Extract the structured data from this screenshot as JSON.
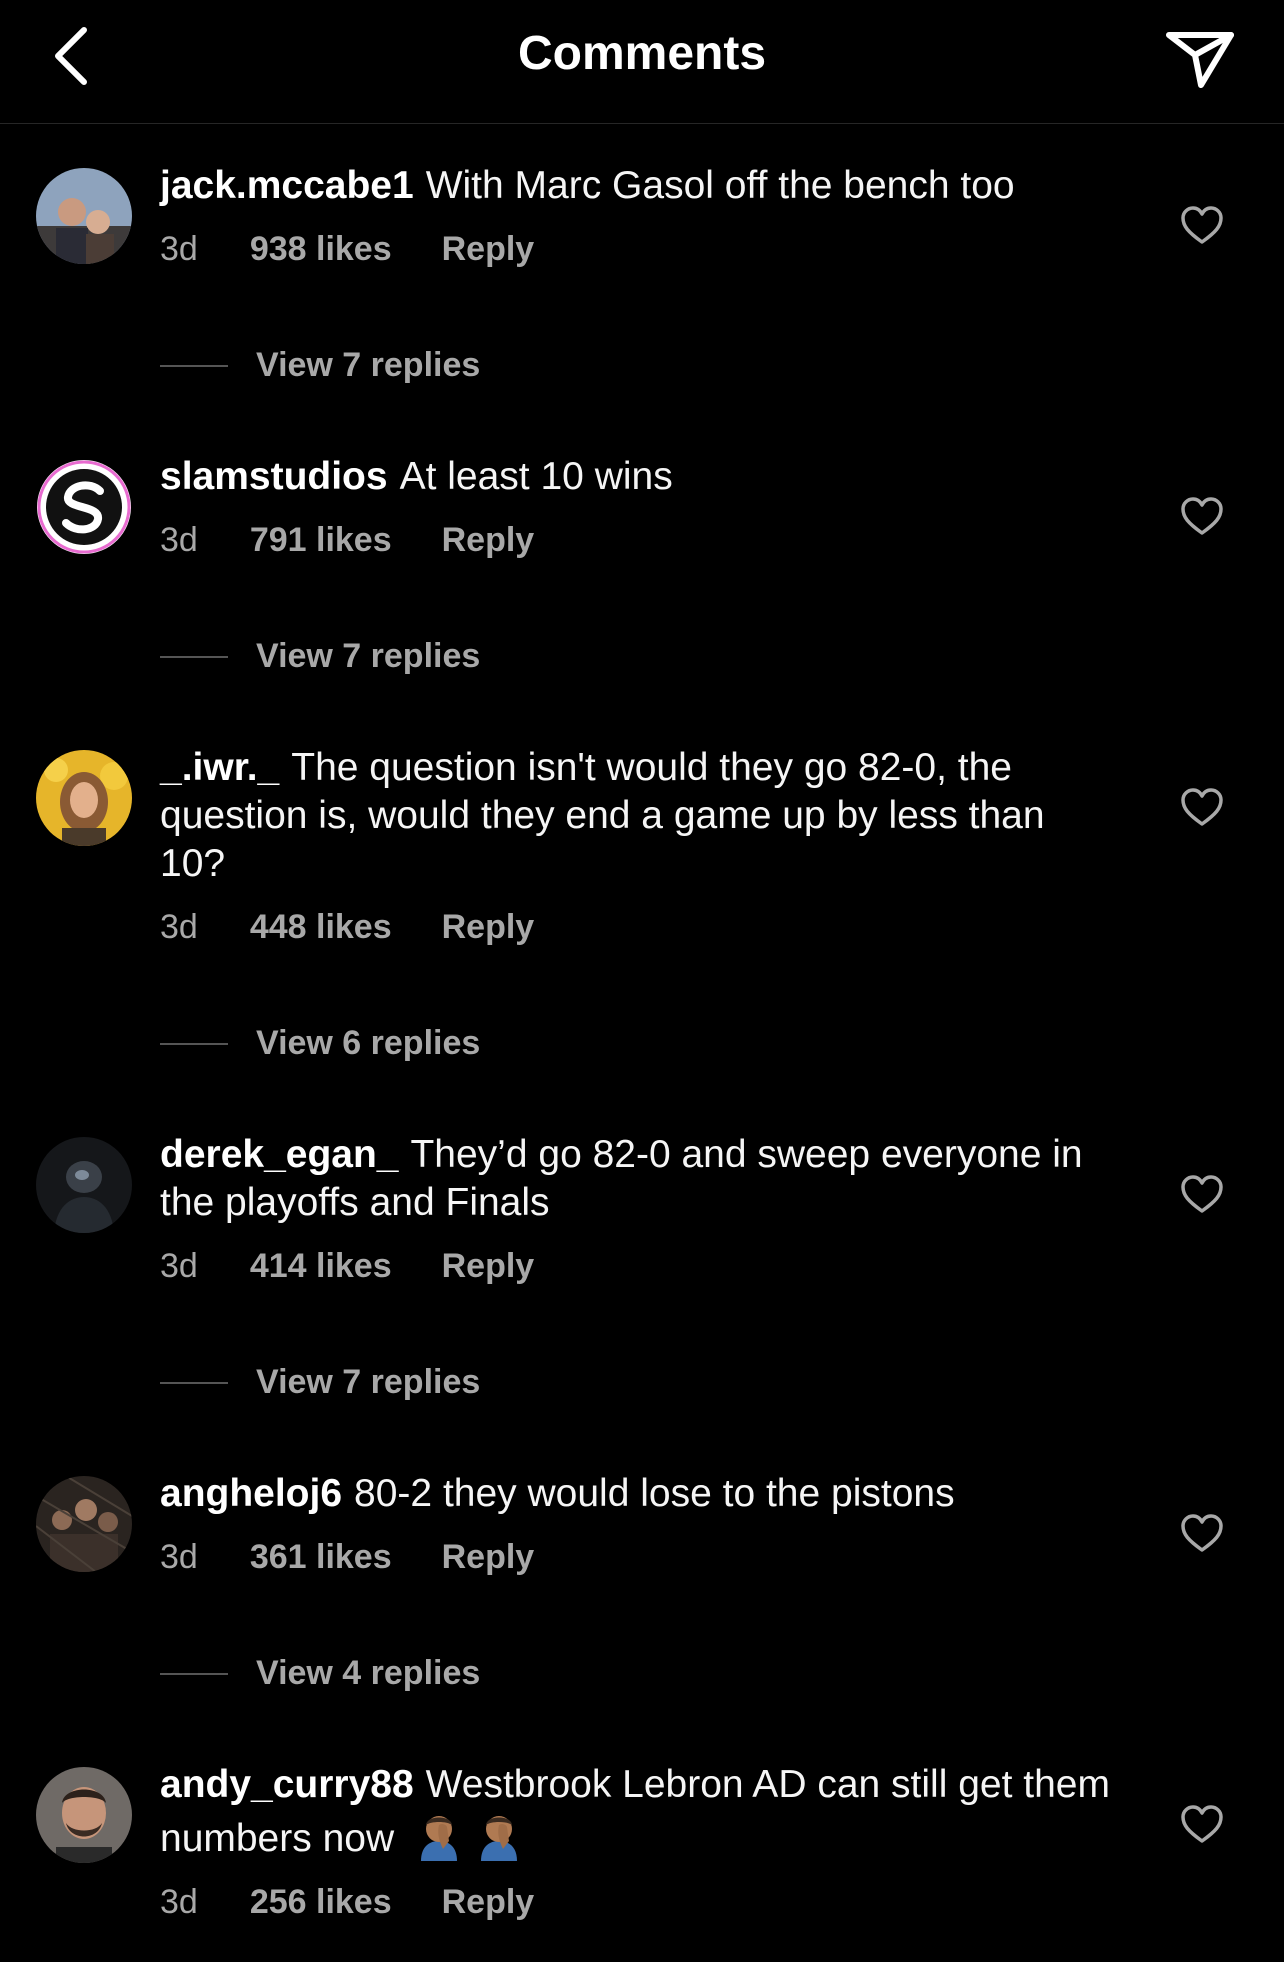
{
  "header": {
    "title": "Comments",
    "back_icon": "chevron-left-icon",
    "send_icon": "paper-plane-icon"
  },
  "comments": [
    {
      "username": "jack.mccabe1",
      "text": "With Marc Gasol off the bench too",
      "time": "3d",
      "likes": "938 likes",
      "reply": "Reply",
      "view_replies": "View 7 replies"
    },
    {
      "username": "slamstudios",
      "text": "At least 10 wins",
      "time": "3d",
      "likes": "791 likes",
      "reply": "Reply",
      "view_replies": "View 7 replies"
    },
    {
      "username": "_.iwr._",
      "text": "The question isn't would they go 82-0, the question is, would they end a game up by less than 10?",
      "time": "3d",
      "likes": "448 likes",
      "reply": "Reply",
      "view_replies": "View 6 replies"
    },
    {
      "username": "derek_egan_",
      "text": "They’d go 82-0 and sweep everyone in the playoffs and Finals",
      "time": "3d",
      "likes": "414 likes",
      "reply": "Reply",
      "view_replies": "View 7 replies"
    },
    {
      "username": "angheloj6",
      "text": "80-2 they would lose to the pistons",
      "time": "3d",
      "likes": "361 likes",
      "reply": "Reply",
      "view_replies": "View 4 replies"
    },
    {
      "username": "andy_curry88",
      "text": "Westbrook Lebron AD can still get them numbers now",
      "emoji": "🤦🏽‍♂️🤦🏽‍♂️",
      "time": "3d",
      "likes": "256 likes",
      "reply": "Reply"
    }
  ],
  "colors": {
    "background": "#000000",
    "text": "#ffffff",
    "secondary_text": "#a8a8a8",
    "divider": "#262626"
  }
}
